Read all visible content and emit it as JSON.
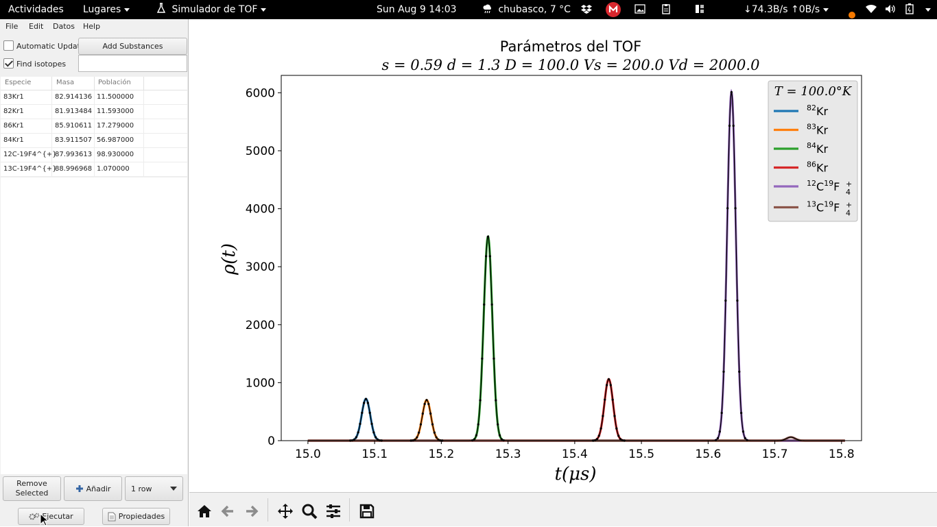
{
  "topbar": {
    "activities": "Actividades",
    "places": "Lugares",
    "app_name": "Simulador de TOF",
    "clock": "Sun Aug 9  14:03",
    "weather": "chubasco, 7 °C",
    "network": "↓74.3B/s ↑0B/s"
  },
  "menu": {
    "file": "File",
    "edit": "Edit",
    "data": "Datos",
    "help": "Help"
  },
  "controls": {
    "auto_update": "Automatic Update",
    "auto_update_checked": false,
    "add_substances": "Add Substances",
    "find_isotopes": "Find isotopes",
    "find_isotopes_checked": true,
    "isotope_query": ""
  },
  "table": {
    "headers": [
      "Especie",
      "Masa",
      "Población"
    ],
    "rows": [
      [
        "83Kr1",
        "82.914136",
        "11.500000"
      ],
      [
        "82Kr1",
        "81.913484",
        "11.593000"
      ],
      [
        "86Kr1",
        "85.910611",
        "17.279000"
      ],
      [
        "84Kr1",
        "83.911507",
        "56.987000"
      ],
      [
        "12C-19F4^{+}",
        "87.993613",
        "98.930000"
      ],
      [
        "13C-19F4^{+}",
        "88.996968",
        "1.070000"
      ]
    ]
  },
  "bottom": {
    "remove_selected": "Remove Selected",
    "add": "Añadir",
    "rows_select": "1 row",
    "run": "Ejecutar",
    "properties": "Propiedades"
  },
  "colors": {
    "c82": "#1f77b4",
    "c83": "#ff7f0e",
    "c84": "#2ca02c",
    "c86": "#d62728",
    "c12": "#9467bd",
    "c13": "#8c564b"
  },
  "chart_data": {
    "type": "line",
    "title": "Parámetros del TOF",
    "subtitle": "s = 0.59  d = 1.3  D = 100.0  Vs = 200.0  Vd = 2000.0",
    "xlabel": "t(μs)",
    "ylabel": "ρ(t)",
    "xlim": [
      14.96,
      15.83
    ],
    "ylim": [
      0,
      6300
    ],
    "xticks": [
      15.0,
      15.1,
      15.2,
      15.3,
      15.4,
      15.5,
      15.6,
      15.7,
      15.8
    ],
    "xtick_labels": [
      "15.0",
      "15.1",
      "15.2",
      "15.3",
      "15.4",
      "15.5",
      "15.6",
      "15.7",
      "15.8"
    ],
    "yticks": [
      0,
      1000,
      2000,
      3000,
      4000,
      5000,
      6000
    ],
    "ytick_labels": [
      "0",
      "1000",
      "2000",
      "3000",
      "4000",
      "5000",
      "6000"
    ],
    "x_range": [
      15.0,
      15.805
    ],
    "grid": false,
    "legend_title": "T = 100.0°K",
    "legend_position": "top-right",
    "series": [
      {
        "name": "82Kr",
        "color": "#1f77b4",
        "peak_t": 15.087,
        "amplitude": 720,
        "width": 0.0065
      },
      {
        "name": "83Kr",
        "color": "#ff7f0e",
        "peak_t": 15.178,
        "amplitude": 700,
        "width": 0.0065
      },
      {
        "name": "84Kr",
        "color": "#2ca02c",
        "peak_t": 15.27,
        "amplitude": 3520,
        "width": 0.0065
      },
      {
        "name": "86Kr",
        "color": "#d62728",
        "peak_t": 15.451,
        "amplitude": 1060,
        "width": 0.0065
      },
      {
        "name": "12C19F4+",
        "color": "#9467bd",
        "peak_t": 15.635,
        "amplitude": 6010,
        "width": 0.0065
      },
      {
        "name": "13C19F4+",
        "color": "#8c564b",
        "peak_t": 15.724,
        "amplitude": 60,
        "width": 0.0065
      }
    ],
    "legend_labels": [
      {
        "sup": "82",
        "base": "Kr",
        "sub": "",
        "subsup": ""
      },
      {
        "sup": "83",
        "base": "Kr",
        "sub": "",
        "subsup": ""
      },
      {
        "sup": "84",
        "base": "Kr",
        "sub": "",
        "subsup": ""
      },
      {
        "sup": "86",
        "base": "Kr",
        "sub": "",
        "subsup": ""
      },
      {
        "sup": "12",
        "base": "C",
        "sup2": "19",
        "base2": "F",
        "sub": "4",
        "subsup": "+"
      },
      {
        "sup": "13",
        "base": "C",
        "sup2": "19",
        "base2": "F",
        "sub": "4",
        "subsup": "+"
      }
    ]
  }
}
